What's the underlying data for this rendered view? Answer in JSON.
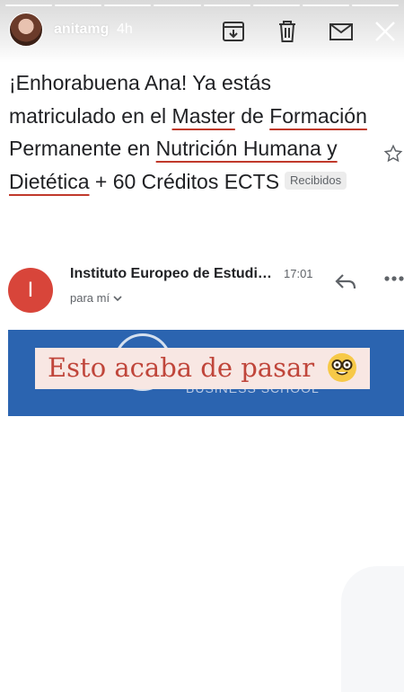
{
  "story": {
    "username": "anitamg",
    "time": "4h"
  },
  "email": {
    "subject_parts": [
      "¡Enhorabuena Ana! Ya estás matriculado en el ",
      "Master",
      " de ",
      "Formación",
      " Permanente en ",
      "Nutrición Humana y Dietética",
      " + 60 Créditos ECTS"
    ],
    "label": "Recibidos",
    "avatar_letter": "I",
    "sender": "Instituto Europeo de Estudios Empresariales",
    "time": "17:01",
    "to": "para mí"
  },
  "banner": {
    "school": "BUSINESS SCHOOL",
    "overlay_text": "Esto acaba de pasar",
    "emoji_icon": "nerd-face-icon"
  },
  "colors": {
    "accent_red": "#c0463b",
    "banner_blue": "#2b64b0",
    "avatar_red": "#d8453a"
  }
}
